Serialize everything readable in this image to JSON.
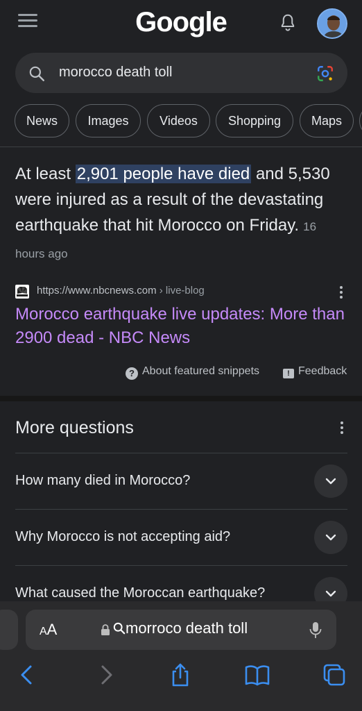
{
  "header": {
    "logo": "Google"
  },
  "search": {
    "query": "morocco death toll"
  },
  "chips": [
    "News",
    "Images",
    "Videos",
    "Shopping",
    "Maps"
  ],
  "snippet": {
    "text_before": "At least ",
    "highlight": "2,901 people have died",
    "text_after": " and 5,530 were injured as a result of the devastating earthquake that hit Morocco on Friday.",
    "time": "16 hours ago",
    "source_url": "https://www.nbcnews.com",
    "source_path": " › live-blog",
    "link_title": "Morocco earthquake live updates: More than 2900 dead - NBC News",
    "about_label": "About featured snippets",
    "feedback_label": "Feedback"
  },
  "more_questions": {
    "title": "More questions",
    "items": [
      "How many died in Morocco?",
      "Why Morocco is not accepting aid?",
      "What caused the Moroccan earthquake?"
    ]
  },
  "browser": {
    "aa_label": "AA",
    "url_text": "morroco death toll"
  },
  "colors": {
    "background": "#202124",
    "link": "#c58af9",
    "highlight": "#2f4161"
  }
}
